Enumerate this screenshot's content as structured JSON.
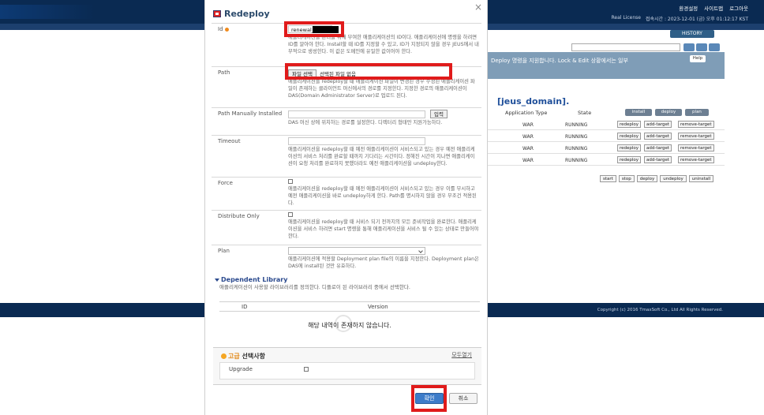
{
  "background": {
    "top_links": [
      "환경설정",
      "사이트맵",
      "로그아웃"
    ],
    "license": "Real License",
    "access_time": "접속시간 : 2023-12-01 (금) 오후 01:12:17 KST",
    "history_label": "HISTORY",
    "banner_text": "Deploy 명령을 지원합니다. Lock & Edit 상황에서는 일부",
    "help_label": "Help",
    "domain_title": "[jeus_domain].",
    "col_app_type": "Application Type",
    "col_state": "State",
    "head_buttons": [
      "install",
      "deploy",
      "plan"
    ],
    "rows": [
      {
        "type": "WAR",
        "state": "RUNNING"
      },
      {
        "type": "WAR",
        "state": "RUNNING"
      },
      {
        "type": "WAR",
        "state": "RUNNING"
      },
      {
        "type": "WAR",
        "state": "RUNNING"
      }
    ],
    "row_buttons": [
      "redeploy",
      "add-target",
      "remove-target"
    ],
    "actions": [
      "start",
      "stop",
      "deploy",
      "undeploy",
      "uninstall"
    ],
    "copyright": "Copyright (c) 2016 TmaxSoft Co., Ltd All Rights Reserved."
  },
  "modal": {
    "title": "Redeploy",
    "close": "×",
    "id": {
      "label": "Id",
      "value": "renewal_",
      "desc": "애플리케이션을 관리를 위해 부여한 애플리케이션의 ID이다. 애플리케이션에 명령을 하려면 ID를 알아야 한다. Install할 때 ID를 지정할 수 있고, ID가 지정되지 않을 경우 JEUS에서 내부적으로 생성한다. 이 값은 도메인에 유일한 값이어야 한다."
    },
    "path": {
      "label": "Path",
      "file_button": "파일 선택",
      "file_status": "선택된 파일 없음",
      "desc": "애플리케이션을 redeploy할 때 애플리케이션 파일이 변경된 경우 수정된 애플리케이션 파일이 존재하는 클라이언트 머신에서의 경로를 지정한다. 지정한 경로의 애플리케이션이 DAS(Domain Administrator Server)로 업로드 된다."
    },
    "path_manual": {
      "label": "Path Manually Installed",
      "button": "입력",
      "desc": "DAS 머신 상에 위치하는 경로를 설정한다. 디렉터리 형태만 지원가능하다."
    },
    "timeout": {
      "label": "Timeout",
      "desc": "애플리케이션을 redeploy할 때 예전 애플리케이션이 서비스되고 있는 경우 예전 애플리케이션의 서비스 처리를 완료할 때까지 기다리는 시간이다. 정해진 시간이 지나면 애플리케이션이 요청 처리를 완료하지 못했더라도 예전 애플리케이션을 undeploy한다."
    },
    "force": {
      "label": "Force",
      "desc": "애플리케이션을 redeploy할 때 예전 애플리케이션이 서비스되고 있는 경우 이를 무시하고 예전 애플리케이션을 바로 undeploy하게 한다. Path를 명시하지 않을 경우 무조건 적용된다."
    },
    "distribute_only": {
      "label": "Distribute Only",
      "desc": "애플리케이션을 redeploy할 때 서비스 되기 전까지의 모든 준비작업을 완료한다. 애플리케이션을 서비스 하려면 start 명령을 통해 애플리케이션을 서비스 될 수 있는 상태로 만들어야 한다."
    },
    "plan": {
      "label": "Plan",
      "desc": "애플리케이션에 적용할 Deployment plan file의 이름을 지정한다. Deployment plan은 DAS에 install된 것만 유효하다."
    },
    "library": {
      "title": "Dependent Library",
      "desc": "애플리케이션이 사용할 라이브러리를 정의한다. 디플로이 된 라이브러리 중에서 선택한다.",
      "col_id": "ID",
      "col_version": "Version",
      "empty": "해당 내역이 존재하지 않습니다."
    },
    "advanced": {
      "title_accent": "고급",
      "title_rest": " 선택사항",
      "expand": "모두열기",
      "upgrade_label": "Upgrade"
    },
    "confirm": "확인",
    "cancel": "취소"
  },
  "colors": {
    "nav_bg": "#0a2a52",
    "highlight": "#e01b1b",
    "confirm": "#3d7cc9"
  }
}
